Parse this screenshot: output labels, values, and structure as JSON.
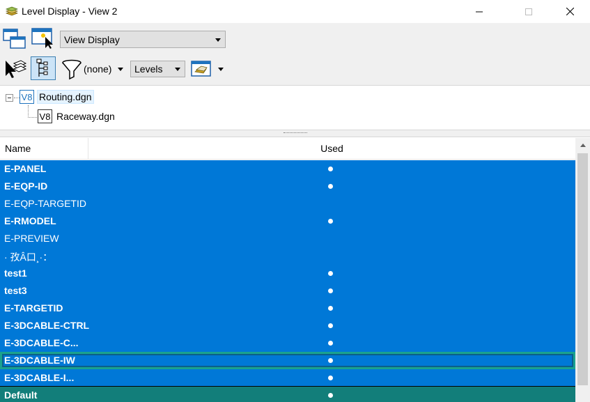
{
  "window": {
    "title": "Level Display - View 2",
    "minimize_glyph": "—",
    "maximize_glyph": "☐",
    "close_glyph": "✕"
  },
  "toolbar": {
    "view_combo_value": "View Display",
    "filter_value": "(none)",
    "levels_combo_value": "Levels"
  },
  "tree": {
    "root": {
      "icon_text": "V8",
      "label": "Routing.dgn"
    },
    "child": {
      "icon_text": "V8",
      "label": "Raceway.dgn"
    }
  },
  "list": {
    "columns": {
      "name": "Name",
      "used": "Used"
    },
    "rows": [
      {
        "name": "E-PANEL",
        "bold": true,
        "used": true
      },
      {
        "name": "E-EQP-ID",
        "bold": true,
        "used": true
      },
      {
        "name": "E-EQP-TARGETID",
        "bold": false,
        "used": false
      },
      {
        "name": "E-RMODEL",
        "bold": true,
        "used": true
      },
      {
        "name": "E-PREVIEW",
        "bold": false,
        "used": false
      },
      {
        "name": "· 孜Â口¸·：",
        "bold": false,
        "used": false
      },
      {
        "name": "test1",
        "bold": true,
        "used": true
      },
      {
        "name": "test3",
        "bold": true,
        "used": true
      },
      {
        "name": "E-TARGETID",
        "bold": true,
        "used": true
      },
      {
        "name": "E-3DCABLE-CTRL",
        "bold": true,
        "used": true
      },
      {
        "name": "E-3DCABLE-C...",
        "bold": true,
        "used": true
      },
      {
        "name": "E-3DCABLE-IW",
        "bold": true,
        "used": true
      },
      {
        "name": "E-3DCABLE-I...",
        "bold": true,
        "used": true
      },
      {
        "name": "Default",
        "bold": true,
        "used": true
      }
    ]
  },
  "colors": {
    "selection": "#0078d7",
    "teal_row": "#127e7a",
    "highlight_border": "#1aa28f"
  }
}
